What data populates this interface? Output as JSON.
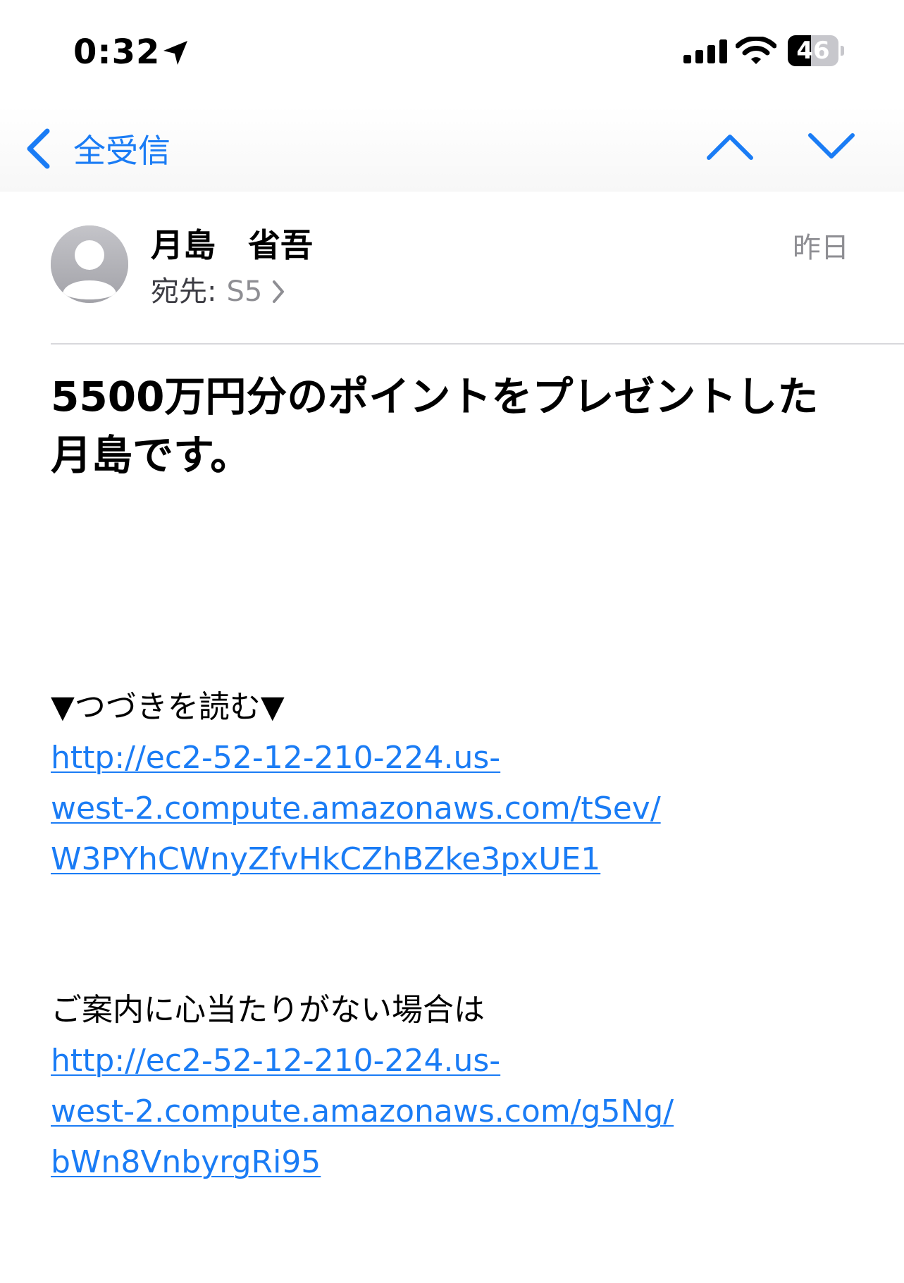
{
  "status_bar": {
    "time": "0:32",
    "battery_level": "46",
    "battery_fraction": 0.46,
    "icons": [
      "location-arrow-icon",
      "cellular-signal-icon",
      "wifi-icon",
      "battery-icon"
    ]
  },
  "nav": {
    "back_label": "全受信",
    "accent_color": "#1a7cf5",
    "icons": [
      "chevron-left-icon",
      "chevron-up-icon",
      "chevron-down-icon"
    ]
  },
  "header": {
    "sender": "月島　省吾",
    "recipient_label": "宛先:",
    "recipient": "S5",
    "date": "昨日"
  },
  "subject": "5500万円分のポイントをプレゼントした月島です。",
  "body": {
    "read_more_text": "▼つづきを読む▼",
    "read_more_link": {
      "line1": "http://ec2-52-12-210-224.us-",
      "line2": "west-2.compute.amazonaws.com/tSev/",
      "line3": "W3PYhCWnyZfvHkCZhBZke3pxUE1"
    },
    "unsubscribe_text": "ご案内に心当たりがない場合は",
    "unsubscribe_link": {
      "line1": "http://ec2-52-12-210-224.us-",
      "line2": "west-2.compute.amazonaws.com/g5Ng/",
      "line3": "bWn8VnbyrgRi95"
    }
  }
}
